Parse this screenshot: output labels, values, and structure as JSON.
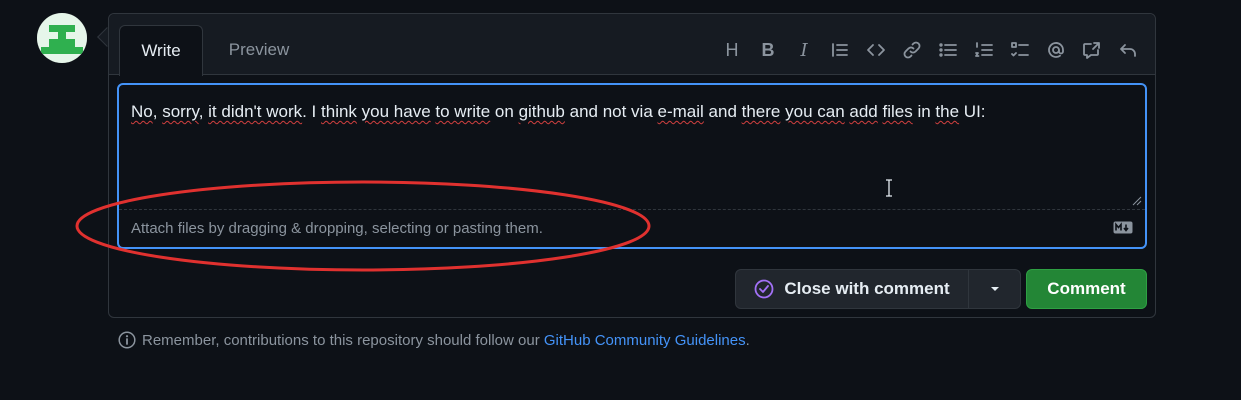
{
  "tabs": {
    "write": "Write",
    "preview": "Preview"
  },
  "toolbar": {
    "items": [
      "heading-icon",
      "bold-icon",
      "italic-icon",
      "quote-icon",
      "code-icon",
      "link-icon",
      "bulleted-list-icon",
      "numbered-list-icon",
      "task-list-icon",
      "mention-icon",
      "reference-icon",
      "undo-icon"
    ],
    "heading_glyph": "H",
    "bold_glyph": "B",
    "italic_glyph": "I"
  },
  "editor": {
    "segments": [
      {
        "text": "No",
        "squiggle": true
      },
      {
        "text": ", ",
        "squiggle": false
      },
      {
        "text": "sorry",
        "squiggle": true
      },
      {
        "text": ", ",
        "squiggle": false
      },
      {
        "text": "it didn't work",
        "squiggle": true
      },
      {
        "text": ". I ",
        "squiggle": false
      },
      {
        "text": "think",
        "squiggle": true
      },
      {
        "text": " ",
        "squiggle": false
      },
      {
        "text": "you have",
        "squiggle": true
      },
      {
        "text": " ",
        "squiggle": false
      },
      {
        "text": "to write",
        "squiggle": true
      },
      {
        "text": " on ",
        "squiggle": false
      },
      {
        "text": "github",
        "squiggle": true
      },
      {
        "text": " and not via ",
        "squiggle": false
      },
      {
        "text": "e-mail",
        "squiggle": true
      },
      {
        "text": " and ",
        "squiggle": false
      },
      {
        "text": "there",
        "squiggle": true
      },
      {
        "text": " ",
        "squiggle": false
      },
      {
        "text": "you can",
        "squiggle": true
      },
      {
        "text": " ",
        "squiggle": false
      },
      {
        "text": "add",
        "squiggle": true
      },
      {
        "text": " ",
        "squiggle": false
      },
      {
        "text": "files",
        "squiggle": true
      },
      {
        "text": " in ",
        "squiggle": false
      },
      {
        "text": "the",
        "squiggle": true
      },
      {
        "text": " UI:",
        "squiggle": false
      }
    ],
    "attach_hint": "Attach files by dragging & dropping, selecting or pasting them."
  },
  "actions": {
    "close_label": "Close with comment",
    "comment_label": "Comment"
  },
  "footer": {
    "prefix": "Remember, contributions to this repository should follow our ",
    "link": "GitHub Community Guidelines",
    "suffix": "."
  },
  "colors": {
    "background": "#0d1117",
    "accent": "#4493f8",
    "primary_button": "#238636",
    "annotation": "#e0312f",
    "close_icon": "#a371f7"
  }
}
